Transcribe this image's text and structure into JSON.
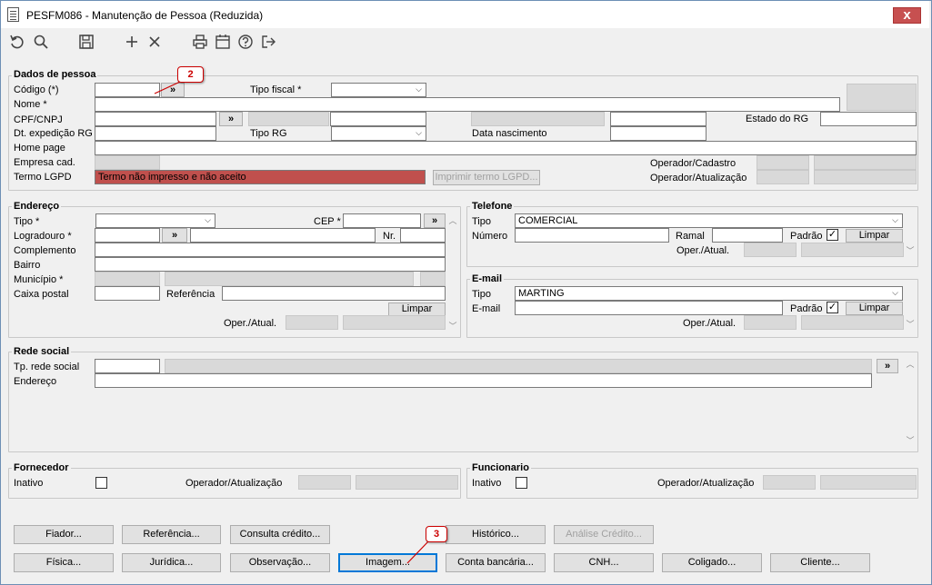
{
  "window": {
    "title": "PESFM086 - Manutenção de Pessoa (Reduzida)",
    "close": "x"
  },
  "toolbar": {
    "icons": [
      "undo-icon",
      "search-icon",
      "save-icon",
      "add-icon",
      "delete-icon",
      "print-icon",
      "calendar-icon",
      "help-icon",
      "exit-icon"
    ]
  },
  "dados": {
    "title": "Dados de pessoa",
    "codigo": "Código (*)",
    "tipo_fiscal": "Tipo fiscal *",
    "nome": "Nome *",
    "cpf": "CPF/CNPJ",
    "estado_rg": "Estado do RG",
    "dt_exp": "Dt. expedição RG",
    "tipo_rg": "Tipo RG",
    "data_nasc": "Data nascimento",
    "home_page": "Home page",
    "empresa": "Empresa cad.",
    "termo": "Termo LGPD",
    "termo_value": "Termo não impresso e não aceito",
    "imprimir": "Imprimir termo LGPD...",
    "op_cad": "Operador/Cadastro",
    "op_atual": "Operador/Atualização"
  },
  "endereco": {
    "title": "Endereço",
    "tipo": "Tipo *",
    "cep": "CEP *",
    "logradouro": "Logradouro *",
    "nr": "Nr.",
    "complemento": "Complemento",
    "bairro": "Bairro",
    "municipio": "Município *",
    "caixa": "Caixa postal",
    "referencia": "Referência",
    "limpar": "Limpar",
    "oper": "Oper./Atual."
  },
  "telefone": {
    "title": "Telefone",
    "tipo": "Tipo",
    "tipo_value": "COMERCIAL",
    "numero": "Número",
    "ramal": "Ramal",
    "padrao": "Padrão",
    "limpar": "Limpar",
    "oper": "Oper./Atual."
  },
  "email": {
    "title": "E-mail",
    "tipo": "Tipo",
    "tipo_value": "MARTING",
    "email": "E-mail",
    "padrao": "Padrão",
    "limpar": "Limpar",
    "oper": "Oper./Atual."
  },
  "rede": {
    "title": "Rede social",
    "tp": "Tp. rede social",
    "endereco": "Endereço"
  },
  "fornecedor": {
    "title": "Fornecedor",
    "inativo": "Inativo",
    "op": "Operador/Atualização"
  },
  "funcionario": {
    "title": "Funcionario",
    "inativo": "Inativo",
    "op": "Operador/Atualização"
  },
  "buttons": {
    "fiador": "Fiador...",
    "referencia": "Referência...",
    "consulta": "Consulta crédito...",
    "historico": "Histórico...",
    "analise": "Análise Crédito...",
    "fisica": "Física...",
    "juridica": "Jurídica...",
    "observacao": "Observação...",
    "imagem": "Imagem...",
    "conta": "Conta bancária...",
    "cnh": "CNH...",
    "coligado": "Coligado...",
    "cliente": "Cliente..."
  },
  "callouts": {
    "c2": "2",
    "c3": "3"
  },
  "symbols": {
    "more": "»",
    "check": "✓",
    "chev": "⌵"
  }
}
